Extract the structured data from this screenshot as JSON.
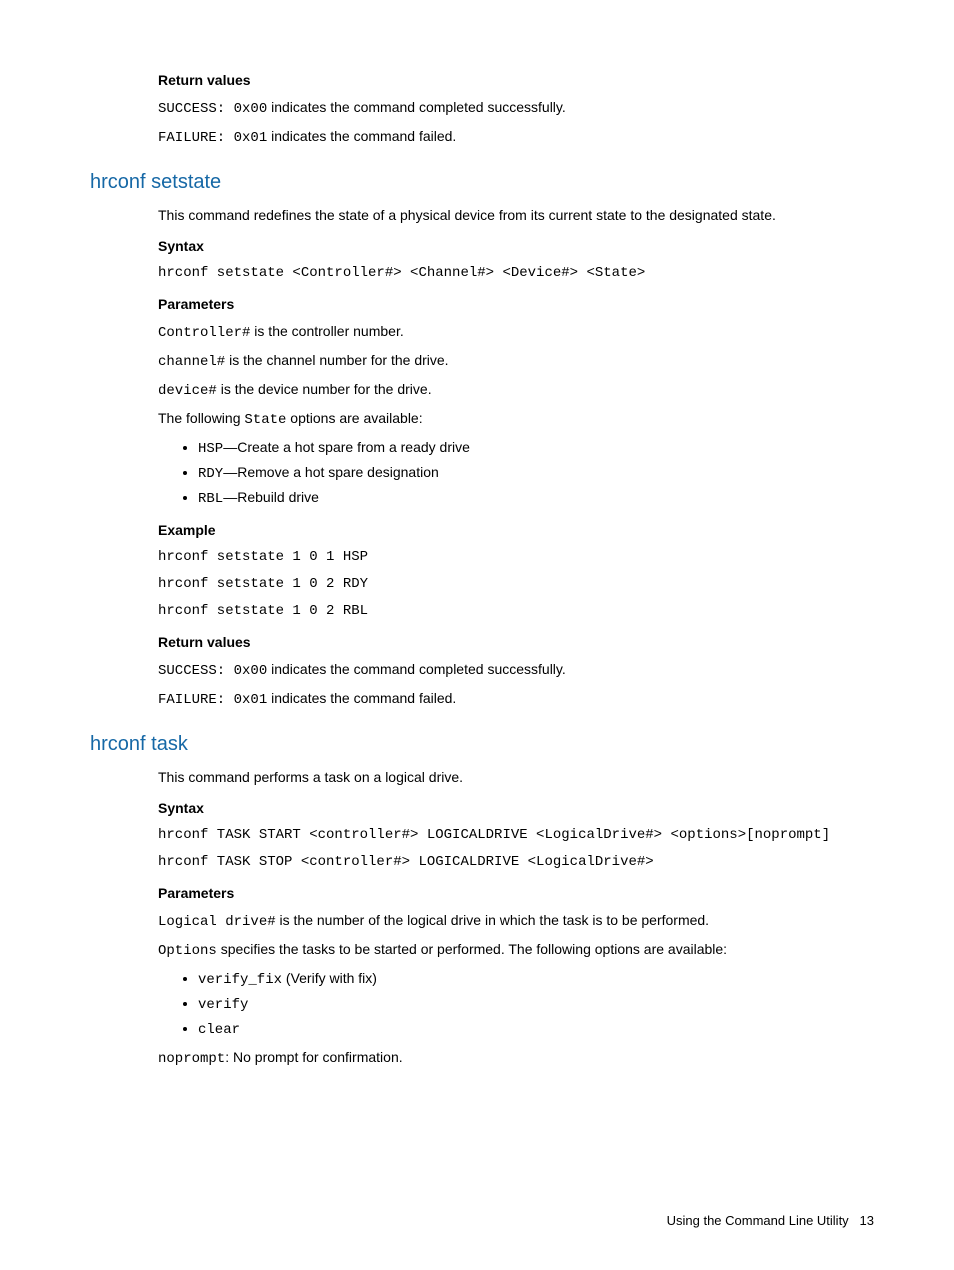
{
  "sec0": {
    "return_values_label": "Return values",
    "rv1_code": "SUCCESS: 0x00",
    "rv1_text": " indicates the command completed successfully.",
    "rv2_code": "FAILURE: 0x01",
    "rv2_text": " indicates the command failed."
  },
  "sec1": {
    "title": "hrconf setstate",
    "intro": "This command redefines the state of a physical device from its current state to the designated state.",
    "syntax_label": "Syntax",
    "syntax_code": "hrconf setstate <Controller#> <Channel#> <Device#> <State>",
    "parameters_label": "Parameters",
    "p1_code": "Controller#",
    "p1_text": " is the controller number.",
    "p2_code": "channel#",
    "p2_text": " is the channel number for the drive.",
    "p3_code": "device#",
    "p3_text": " is the device number for the drive.",
    "p4_pre": "The following ",
    "p4_code": "State",
    "p4_post": " options are available:",
    "opt1_code": "HSP",
    "opt1_text": "—Create a hot spare from a ready drive",
    "opt2_code": "RDY",
    "opt2_text": "—Remove a hot spare designation",
    "opt3_code": "RBL",
    "opt3_text": "—Rebuild drive",
    "example_label": "Example",
    "ex1": "hrconf setstate 1 0 1 HSP",
    "ex2": "hrconf setstate 1 0 2 RDY",
    "ex3": "hrconf setstate 1 0 2 RBL",
    "return_values_label": "Return values",
    "rv1_code": "SUCCESS: 0x00",
    "rv1_text": " indicates the command completed successfully.",
    "rv2_code": "FAILURE: 0x01",
    "rv2_text": " indicates the command failed."
  },
  "sec2": {
    "title": "hrconf task",
    "intro": "This command performs a task on a logical drive.",
    "syntax_label": "Syntax",
    "syntax1": "hrconf TASK START <controller#> LOGICALDRIVE <LogicalDrive#> <options>[noprompt]",
    "syntax2": "hrconf TASK STOP <controller#> LOGICALDRIVE <LogicalDrive#>",
    "parameters_label": "Parameters",
    "p1_code": "Logical drive#",
    "p1_text": " is the number of the logical drive in which the task is to be performed.",
    "p2_code": "Options",
    "p2_text": " specifies the tasks to be started or performed. The following options are available:",
    "opt1_code": "verify_fix",
    "opt1_text": " (Verify with fix)",
    "opt2_code": "verify",
    "opt3_code": "clear",
    "np_code": "noprompt",
    "np_text": ": No prompt for confirmation."
  },
  "footer": {
    "text": "Using the Command Line Utility",
    "page": "13"
  }
}
